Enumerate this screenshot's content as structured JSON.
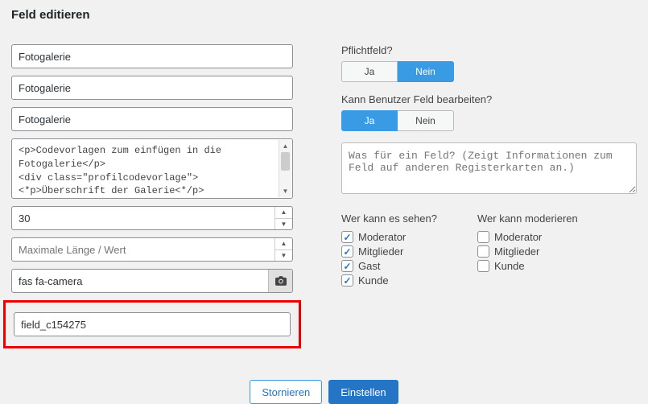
{
  "title": "Feld editieren",
  "fields": {
    "f1": "Fotogalerie",
    "f2": "Fotogalerie",
    "f3": "Fotogalerie",
    "code": "<p>Codevorlagen zum einfügen in die Fotogalerie</p>\n<div class=\"profilcodevorlage\">\n<*p>Überschrift der Galerie<*/p>\n</div>",
    "num1": "30",
    "maxlen_placeholder": "Maximale Länge / Wert",
    "icon_class": "fas fa-camera",
    "field_key": "field_c154275"
  },
  "right": {
    "required_label": "Pflichtfeld?",
    "required": {
      "yes": "Ja",
      "no": "Nein",
      "active": "no"
    },
    "editable_label": "Kann Benutzer Feld bearbeiten?",
    "editable": {
      "yes": "Ja",
      "no": "Nein",
      "active": "yes"
    },
    "desc_placeholder": "Was für ein Feld? (Zeigt Informationen zum Feld auf anderen Registerkarten an.)"
  },
  "perms": {
    "see_title": "Wer kann es sehen?",
    "mod_title": "Wer kann moderieren",
    "see": [
      {
        "label": "Moderator",
        "checked": true
      },
      {
        "label": "Mitglieder",
        "checked": true
      },
      {
        "label": "Gast",
        "checked": true
      },
      {
        "label": "Kunde",
        "checked": true
      }
    ],
    "mod": [
      {
        "label": "Moderator",
        "checked": false
      },
      {
        "label": "Mitglieder",
        "checked": false
      },
      {
        "label": "Kunde",
        "checked": false
      }
    ]
  },
  "footer": {
    "cancel": "Stornieren",
    "submit": "Einstellen"
  }
}
